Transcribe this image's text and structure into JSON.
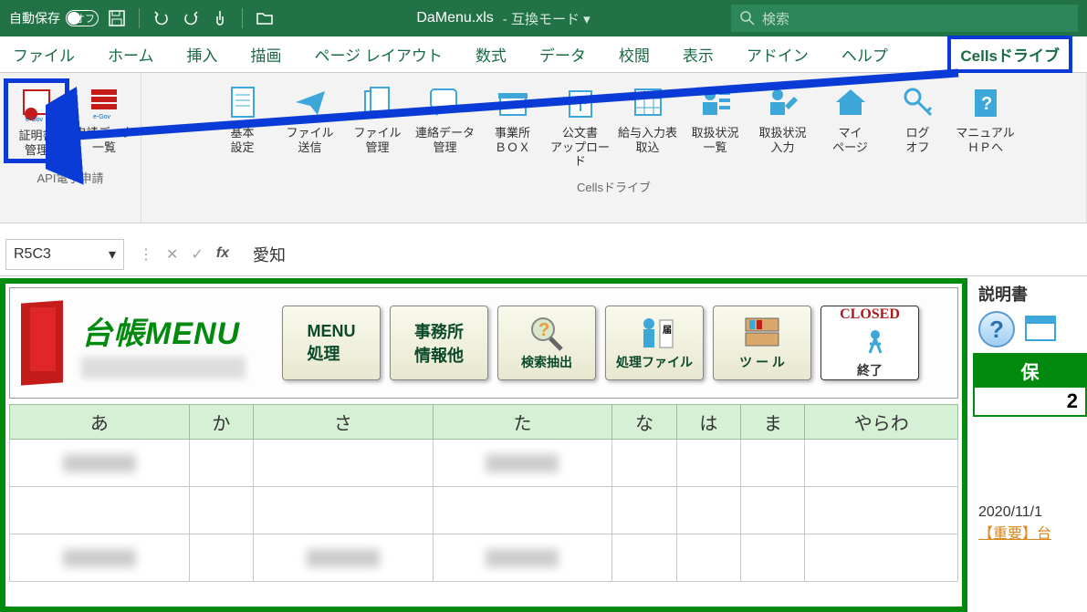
{
  "titlebar": {
    "autosave_label": "自動保存",
    "autosave_state": "オフ",
    "filename": "DaMenu.xls",
    "compat_mode": "- 互換モード ▾",
    "search_placeholder": "検索"
  },
  "menutabs": {
    "file": "ファイル",
    "home": "ホーム",
    "insert": "挿入",
    "draw": "描画",
    "layout": "ページ レイアウト",
    "formula": "数式",
    "data": "データ",
    "review": "校閲",
    "view": "表示",
    "addin": "アドイン",
    "help": "ヘルプ",
    "cellsdrive": "Cellsドライブ"
  },
  "ribbon": {
    "group1_label": "API電子申請",
    "group2_label": "Cellsドライブ",
    "buttons": {
      "cert": "証明書\n管理",
      "appdata": "申請データ\n一覧",
      "basic": "基本\n設定",
      "filesend": "ファイル\n送信",
      "filemgmt": "ファイル\n管理",
      "contact": "連絡データ\n管理",
      "box": "事業所\nＢＯＸ",
      "upload": "公文書\nアップロード",
      "payroll": "給与入力表\n取込",
      "status1": "取扱状況\n一覧",
      "status2": "取扱状況\n入力",
      "mypage": "マイ\nページ",
      "logoff": "ログ\nオフ",
      "manual": "マニュアル\nＨＰへ"
    }
  },
  "formulabar": {
    "namebox": "R5C3",
    "value": "愛知"
  },
  "menu_panel": {
    "title": "台帳MENU",
    "btn_menu": "MENU\n処理",
    "btn_office": "事務所\n情報他",
    "btn_search": "検索抽出",
    "btn_process": "処理ファイル",
    "btn_tool": "ツ ー ル",
    "btn_closed": "CLOSED",
    "btn_exit": "終了"
  },
  "kana_headers": [
    "あ",
    "か",
    "さ",
    "た",
    "な",
    "は",
    "ま",
    "やらわ"
  ],
  "right_panel": {
    "title": "説明書",
    "green_label": "保",
    "big_number": "2",
    "news_date": "2020/11/1",
    "news_link": "【重要】台"
  }
}
